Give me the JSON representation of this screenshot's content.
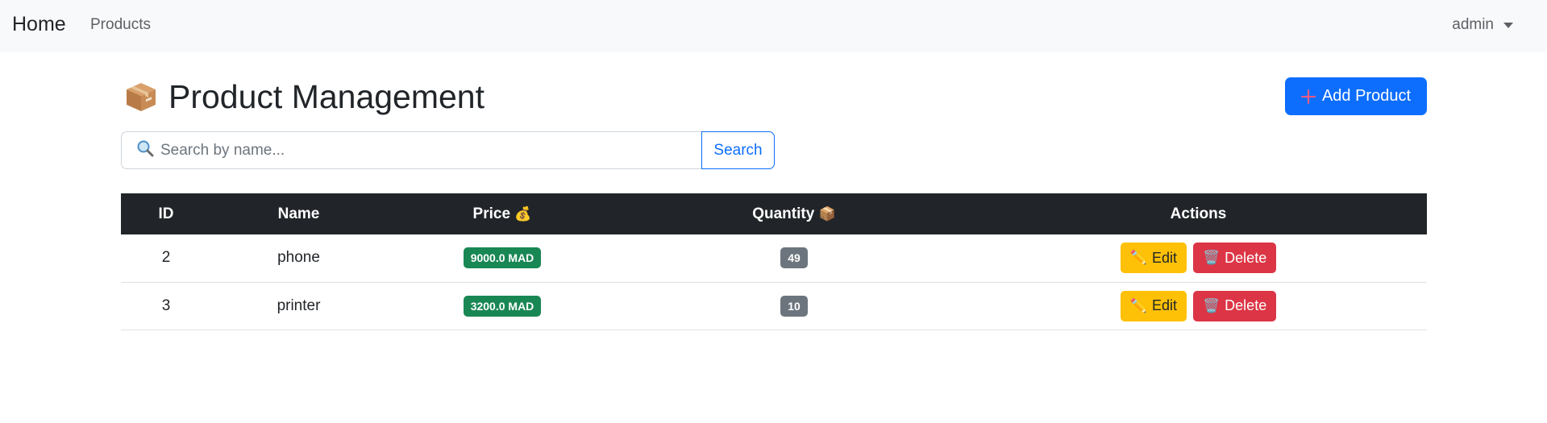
{
  "nav": {
    "brand": "Home",
    "links": [
      "Products"
    ],
    "user": "admin"
  },
  "header": {
    "title": "Product Management",
    "add_label": "Add Product"
  },
  "search": {
    "placeholder": "Search by name...",
    "button_label": "Search"
  },
  "table": {
    "headers": {
      "id": "ID",
      "name": "Name",
      "price": "Price",
      "quantity": "Quantity",
      "actions": "Actions"
    },
    "rows": [
      {
        "id": "2",
        "name": "phone",
        "price": "9000.0 MAD",
        "quantity": "49"
      },
      {
        "id": "3",
        "name": "printer",
        "price": "3200.0 MAD",
        "quantity": "10"
      }
    ],
    "edit_label": "Edit",
    "delete_label": "Delete"
  },
  "icons": {
    "title": "package-icon",
    "add": "plus-icon",
    "search": "magnifier-icon",
    "price": "money-bag-icon",
    "quantity": "package-icon",
    "edit": "pencil-icon",
    "delete": "wastebasket-icon"
  },
  "colors": {
    "primary": "#0d6efd",
    "success": "#198754",
    "secondary": "#6c757d",
    "warning": "#ffc107",
    "danger": "#dc3545",
    "dark": "#212529"
  }
}
